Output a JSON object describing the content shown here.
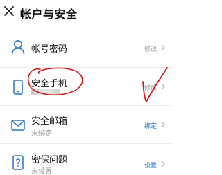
{
  "header": {
    "title": "帐户与安全"
  },
  "rows": [
    {
      "title": "帐号密码",
      "subtitle": "",
      "action": "修改"
    },
    {
      "title": "安全手机",
      "subtitle": "",
      "action": "修改"
    },
    {
      "title": "安全邮箱",
      "subtitle": "未绑定",
      "action": "绑定"
    },
    {
      "title": "密保问题",
      "subtitle": "未设置",
      "action": "设置"
    }
  ],
  "icons": {
    "close": "close-icon",
    "account": "user-icon",
    "phone": "phone-icon",
    "email": "envelope-icon",
    "security_question": "question-icon",
    "chevron": "chevron-right-icon"
  },
  "colors": {
    "accent_blue": "#2a72c9",
    "annotation_red": "#d21a1a",
    "divider": "#ececec"
  }
}
